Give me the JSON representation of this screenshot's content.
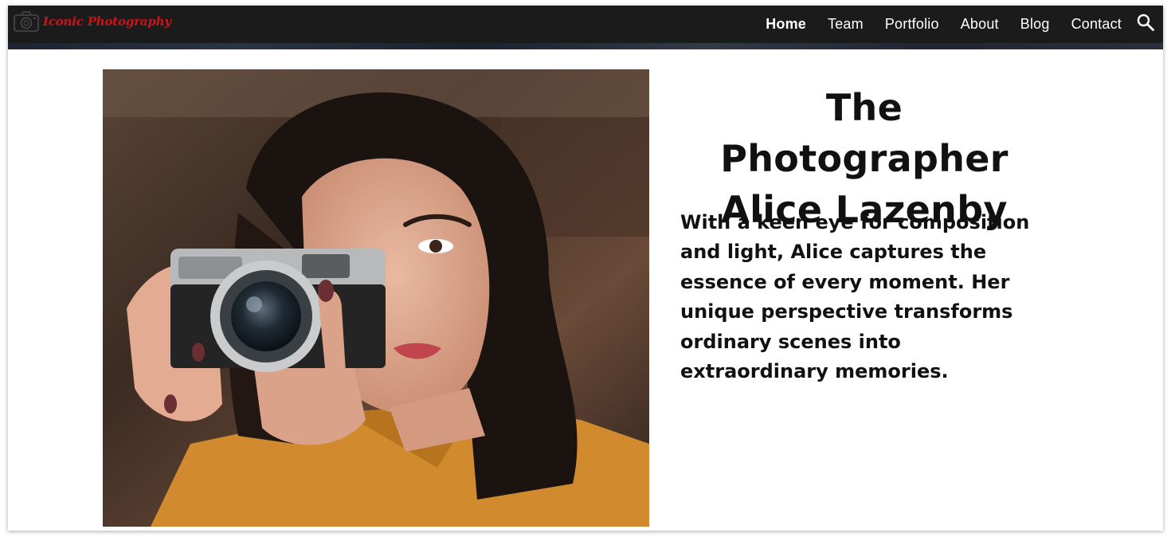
{
  "header": {
    "logo": {
      "text": "Iconic Photography",
      "icon": "camera-icon",
      "color": "#c8161d"
    },
    "nav": [
      {
        "label": "Home",
        "active": true
      },
      {
        "label": "Team",
        "active": false
      },
      {
        "label": "Portfolio",
        "active": false
      },
      {
        "label": "About",
        "active": false
      },
      {
        "label": "Blog",
        "active": false
      },
      {
        "label": "Contact",
        "active": false
      }
    ],
    "search_icon": "search-icon",
    "background": "#1b1b1b"
  },
  "main": {
    "photo": {
      "subject": "woman-holding-camera"
    },
    "title": {
      "line1": "The Photographer",
      "line2": "Alice Lazenby"
    },
    "bio": "With a keen eye for composition and light, Alice captures the essence of every moment. Her unique perspective transforms ordinary scenes into extraordinary memories."
  }
}
